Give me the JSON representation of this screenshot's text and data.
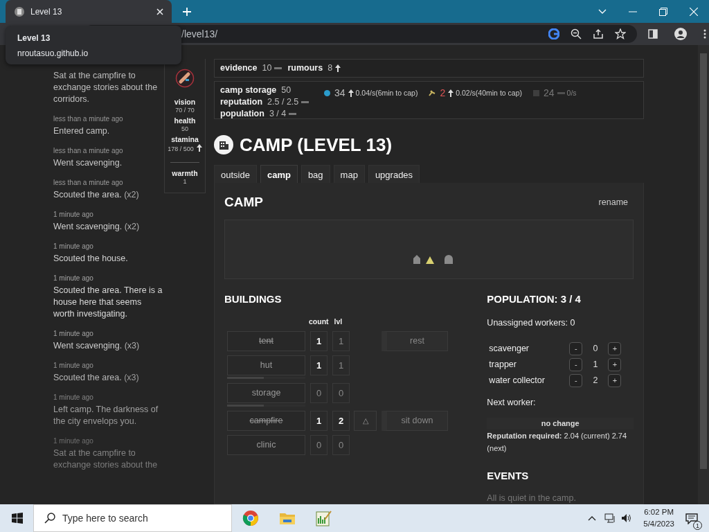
{
  "browser": {
    "tab": {
      "title": "Level 13",
      "selected": true
    },
    "tooltip": {
      "title": "Level 13",
      "host": "nroutasuo.github.io"
    },
    "address": "/level13/"
  },
  "log": [
    {
      "text": "Sat at the campfire to exchange stories about the corridors."
    },
    {
      "time": "less than a minute ago",
      "text": "Entered camp."
    },
    {
      "time": "less than a minute ago",
      "text": "Went scavenging."
    },
    {
      "time": "less than a minute ago",
      "text": "Scouted the area.",
      "repeat": "(x2)"
    },
    {
      "time": "1 minute ago",
      "text": "Went scavenging.",
      "repeat": "(x2)"
    },
    {
      "time": "1 minute ago",
      "text": "Scouted the house."
    },
    {
      "time": "1 minute ago",
      "text": "Scouted the area. There is a house here that seems worth investigating."
    },
    {
      "time": "1 minute ago",
      "text": "Went scavenging.",
      "repeat": "(x3)"
    },
    {
      "time": "1 minute ago",
      "text": "Scouted the area.",
      "repeat": "(x3)"
    },
    {
      "time": "1 minute ago",
      "text": "Left camp. The darkness of the city envelops you."
    },
    {
      "time": "1 minute ago",
      "text": "Sat at the campfire to exchange stories about the"
    }
  ],
  "stats": [
    {
      "label": "vision",
      "value": "70 / 70"
    },
    {
      "label": "health",
      "value": "50"
    },
    {
      "label": "stamina",
      "value": "178 / 500",
      "rising": true
    },
    {
      "label": "warmth",
      "value": "1",
      "kind": "separated"
    }
  ],
  "evidence": [
    {
      "label": "evidence",
      "value": "10",
      "rising": false
    },
    {
      "label": "rumours",
      "value": "8",
      "rising": true
    }
  ],
  "camp_stats": [
    {
      "label": "camp storage",
      "value": "50"
    },
    {
      "label": "reputation",
      "value": "2.5 / 2.5",
      "rising": false
    },
    {
      "label": "population",
      "value": "3 / 4",
      "rising": false
    }
  ],
  "resources": [
    {
      "kind": "water",
      "value": "34",
      "rising": true,
      "rate": "0.04/s(6min to cap)",
      "warning": false,
      "dimmed": false
    },
    {
      "kind": "food",
      "value": "2",
      "rising": true,
      "rate": "0.02/s(40min to cap)",
      "warning": true,
      "dimmed": false
    },
    {
      "kind": "metal",
      "value": "24",
      "rising": false,
      "rate": "0/s",
      "warning": false,
      "dimmed": true
    }
  ],
  "title": "CAMP (LEVEL 13)",
  "tabs": [
    {
      "label": "outside",
      "selected": false
    },
    {
      "label": "camp",
      "selected": true
    },
    {
      "label": "bag",
      "selected": false
    },
    {
      "label": "map",
      "selected": false
    },
    {
      "label": "upgrades",
      "selected": false
    }
  ],
  "panel": {
    "title": "CAMP",
    "rename": "rename"
  },
  "buildings": {
    "title": "BUILDINGS",
    "columns": [
      "count",
      "lvl"
    ],
    "rows": [
      {
        "name": "tent",
        "struck": true,
        "count": "1",
        "count_active": true,
        "lvl": "1",
        "lvl_active": false,
        "action": "rest"
      },
      {
        "name": "hut",
        "struck": false,
        "count": "1",
        "count_active": true,
        "lvl": "1",
        "lvl_active": false,
        "level": 0.47
      },
      {
        "name": "storage",
        "struck": false,
        "count": "0",
        "count_active": false,
        "lvl": "0",
        "lvl_active": false,
        "level": 0.47
      },
      {
        "name": "campfire",
        "struck": true,
        "count": "1",
        "count_active": true,
        "lvl": "2",
        "lvl_active": true,
        "upgrade": "△",
        "action": "sit down"
      },
      {
        "name": "clinic",
        "struck": false,
        "count": "0",
        "count_active": false,
        "lvl": "0",
        "lvl_active": false
      }
    ]
  },
  "population": {
    "title": "POPULATION: 3 / 4",
    "unassigned": "Unassigned workers: 0",
    "workers": [
      {
        "name": "scavenger",
        "value": "0",
        "dec": "-",
        "inc": "+"
      },
      {
        "name": "trapper",
        "value": "1",
        "dec": "-",
        "inc": "+"
      },
      {
        "name": "water collector",
        "value": "2",
        "dec": "-",
        "inc": "+"
      }
    ],
    "next_label": "Next worker:",
    "next_status": "no change",
    "requirement": "**Reputation required:** 2.04 (current) 2.74 (next)"
  },
  "events": {
    "title": "EVENTS",
    "text": "All is quiet in the camp."
  },
  "taskbar": {
    "search_placeholder": "Type here to search",
    "time": "6:02 PM",
    "date": "5/4/2023",
    "notifications": "1"
  }
}
